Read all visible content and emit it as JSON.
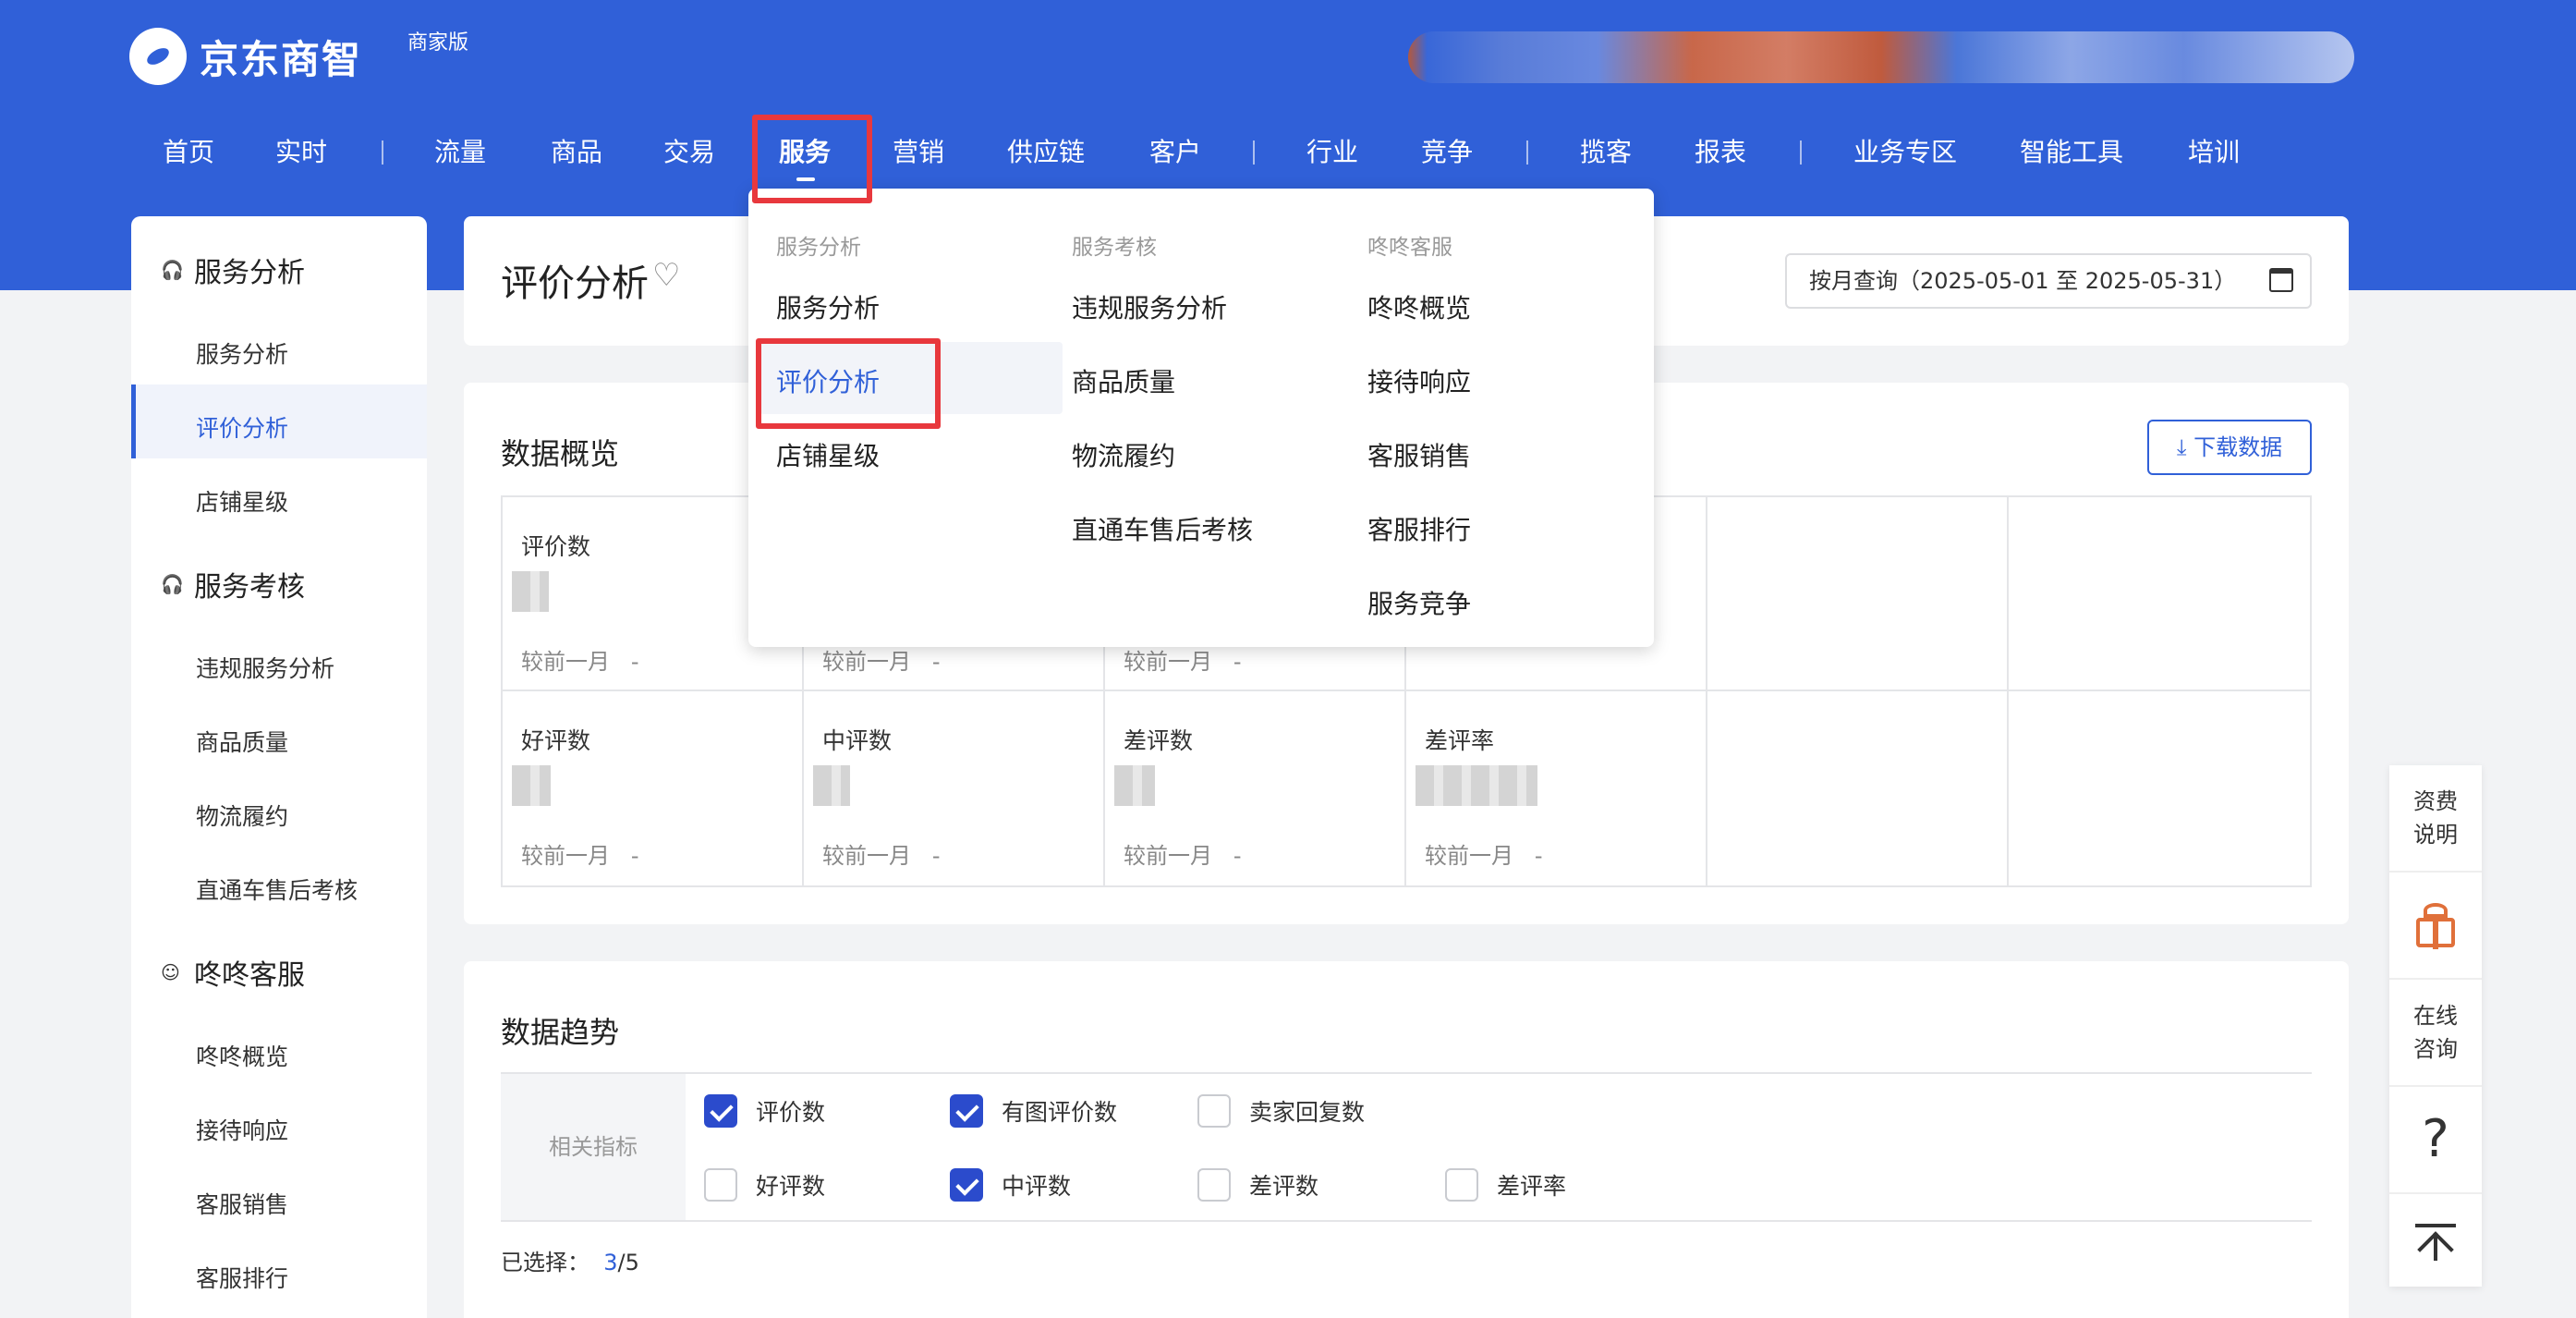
{
  "brand": {
    "name": "京东商智",
    "edition": "商家版"
  },
  "nav": {
    "items": [
      "首页",
      "实时",
      "流量",
      "商品",
      "交易",
      "服务",
      "营销",
      "供应链",
      "客户",
      "行业",
      "竞争",
      "揽客",
      "报表",
      "业务专区",
      "智能工具",
      "培训"
    ],
    "active": "服务"
  },
  "sidebar": {
    "groups": [
      {
        "title": "服务分析",
        "icon": "headset-icon",
        "items": [
          "服务分析",
          "评价分析",
          "店铺星级"
        ]
      },
      {
        "title": "服务考核",
        "icon": "headset-icon",
        "items": [
          "违规服务分析",
          "商品质量",
          "物流履约",
          "直通车售后考核"
        ]
      },
      {
        "title": "咚咚客服",
        "icon": "chat-icon",
        "items": [
          "咚咚概览",
          "接待响应",
          "客服销售",
          "客服排行"
        ]
      }
    ],
    "active_item": "评价分析"
  },
  "header": {
    "title": "评价分析",
    "date_query": "按月查询（2025-05-01 至 2025-05-31）"
  },
  "dropdown": {
    "columns": [
      {
        "heading": "服务分析",
        "items": [
          "服务分析",
          "评价分析",
          "店铺星级"
        ]
      },
      {
        "heading": "服务考核",
        "items": [
          "违规服务分析",
          "商品质量",
          "物流履约",
          "直通车售后考核"
        ]
      },
      {
        "heading": "咚咚客服",
        "items": [
          "咚咚概览",
          "接待响应",
          "客服销售",
          "客服排行",
          "服务竞争"
        ]
      }
    ],
    "active_item": "评价分析"
  },
  "overview": {
    "title": "数据概览",
    "download_label": "下载数据",
    "compare_label": "较前一月",
    "compare_value": "-",
    "cells": [
      {
        "label": "评价数"
      },
      {
        "label": ""
      },
      {
        "label": ""
      },
      {
        "label": ""
      },
      {
        "label": "好评数"
      },
      {
        "label": "中评数"
      },
      {
        "label": "差评数"
      },
      {
        "label": "差评率"
      }
    ]
  },
  "trend": {
    "title": "数据趋势",
    "metric_label": "相关指标",
    "options": [
      {
        "label": "评价数",
        "checked": true
      },
      {
        "label": "有图评价数",
        "checked": true
      },
      {
        "label": "卖家回复数",
        "checked": false
      },
      {
        "label": "好评数",
        "checked": false
      },
      {
        "label": "中评数",
        "checked": true
      },
      {
        "label": "差评数",
        "checked": false
      },
      {
        "label": "差评率",
        "checked": false
      }
    ],
    "selected_label": "已选择：",
    "selected_count": "3",
    "selected_total": "/5"
  },
  "float_panel": {
    "fee_label": "资费说明",
    "consult_label": "在线咨询",
    "help_label": "?"
  },
  "colors": {
    "brand_blue": "#3060d8",
    "highlight_red": "#e8383d",
    "checkbox_blue": "#2b4bcc"
  }
}
